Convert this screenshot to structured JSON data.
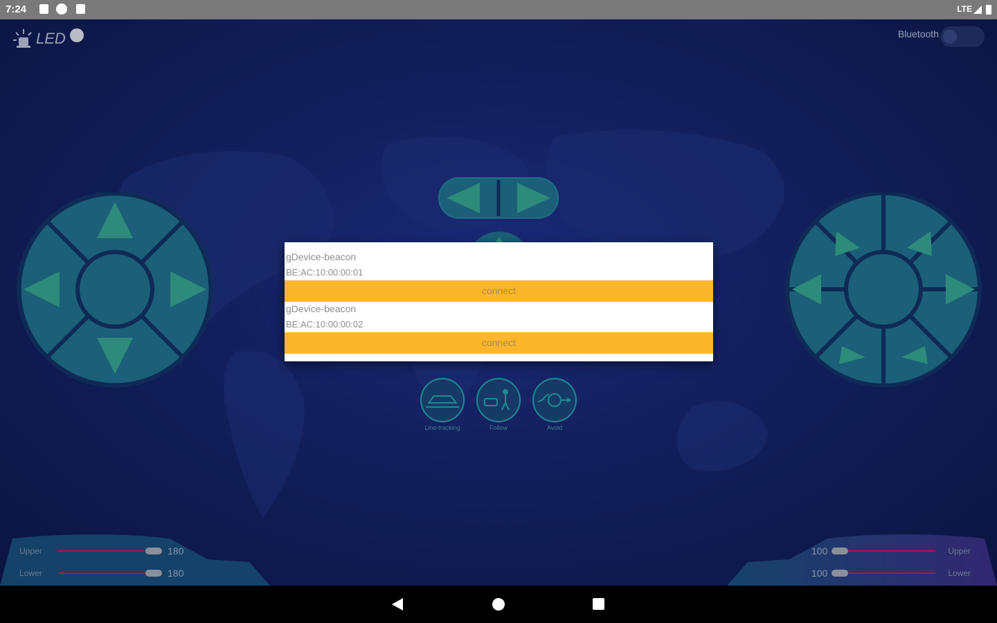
{
  "status_bar": {
    "time": "7:24",
    "network": "LTE",
    "icons": [
      "notification-icon",
      "pocket-icon",
      "sd-card-icon",
      "signal-icon",
      "battery-icon"
    ]
  },
  "header": {
    "led_label": "LED",
    "bluetooth_label": "Bluetooth",
    "bluetooth_on": false
  },
  "modes": [
    {
      "label": "Line-tracking",
      "icon": "car-line-icon"
    },
    {
      "label": "Follow",
      "icon": "follow-person-icon"
    },
    {
      "label": "Avoid",
      "icon": "avoid-obstacle-icon"
    }
  ],
  "sliders_left": [
    {
      "label": "Upper",
      "value": "180"
    },
    {
      "label": "Lower",
      "value": "180"
    }
  ],
  "sliders_right": [
    {
      "label": "Upper",
      "value": "100"
    },
    {
      "label": "Lower",
      "value": "100"
    }
  ],
  "dialog": {
    "devices": [
      {
        "name": "gDevice-beacon",
        "address": "BE:AC:10:00:00:01",
        "button": "connect"
      },
      {
        "name": "gDevice-beacon",
        "address": "BE:AC:10:00:00:02",
        "button": "connect"
      }
    ]
  },
  "colors": {
    "accent": "#fbb62b",
    "pad": "#1b5f78",
    "background": "#13205e"
  }
}
